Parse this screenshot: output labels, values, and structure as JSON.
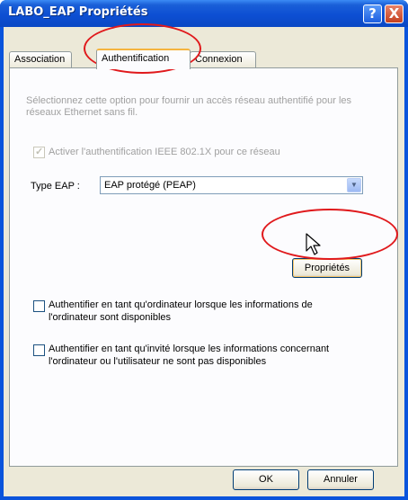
{
  "window": {
    "title": "LABO_EAP Propriétés",
    "help_glyph": "?",
    "close_glyph": "X"
  },
  "tabs": [
    {
      "label": "Association"
    },
    {
      "label": "Authentification",
      "selected": true
    },
    {
      "label": "Connexion"
    }
  ],
  "panel": {
    "description": "Sélectionnez cette option pour fournir un accès réseau authentifié pour les réseaux Ethernet sans fil.",
    "enable_8021x": {
      "label": "Activer l'authentification IEEE 802.1X pour ce réseau",
      "checked": true,
      "enabled": false
    },
    "eap_type": {
      "label": "Type EAP :",
      "value": "EAP protégé (PEAP)"
    },
    "properties_button": "Propriétés",
    "auth_computer": {
      "label_line1": "Authentifier en tant qu'ordinateur lorsque les informations de",
      "label_line2": "l'ordinateur sont disponibles",
      "checked": false
    },
    "auth_guest": {
      "label_line1": "Authentifier en tant qu'invité lorsque les informations concernant",
      "label_line2": "l'ordinateur ou l'utilisateur ne sont pas disponibles",
      "checked": false
    }
  },
  "footer": {
    "ok": "OK",
    "cancel": "Annuler"
  },
  "annotation_color": "#e0191c"
}
